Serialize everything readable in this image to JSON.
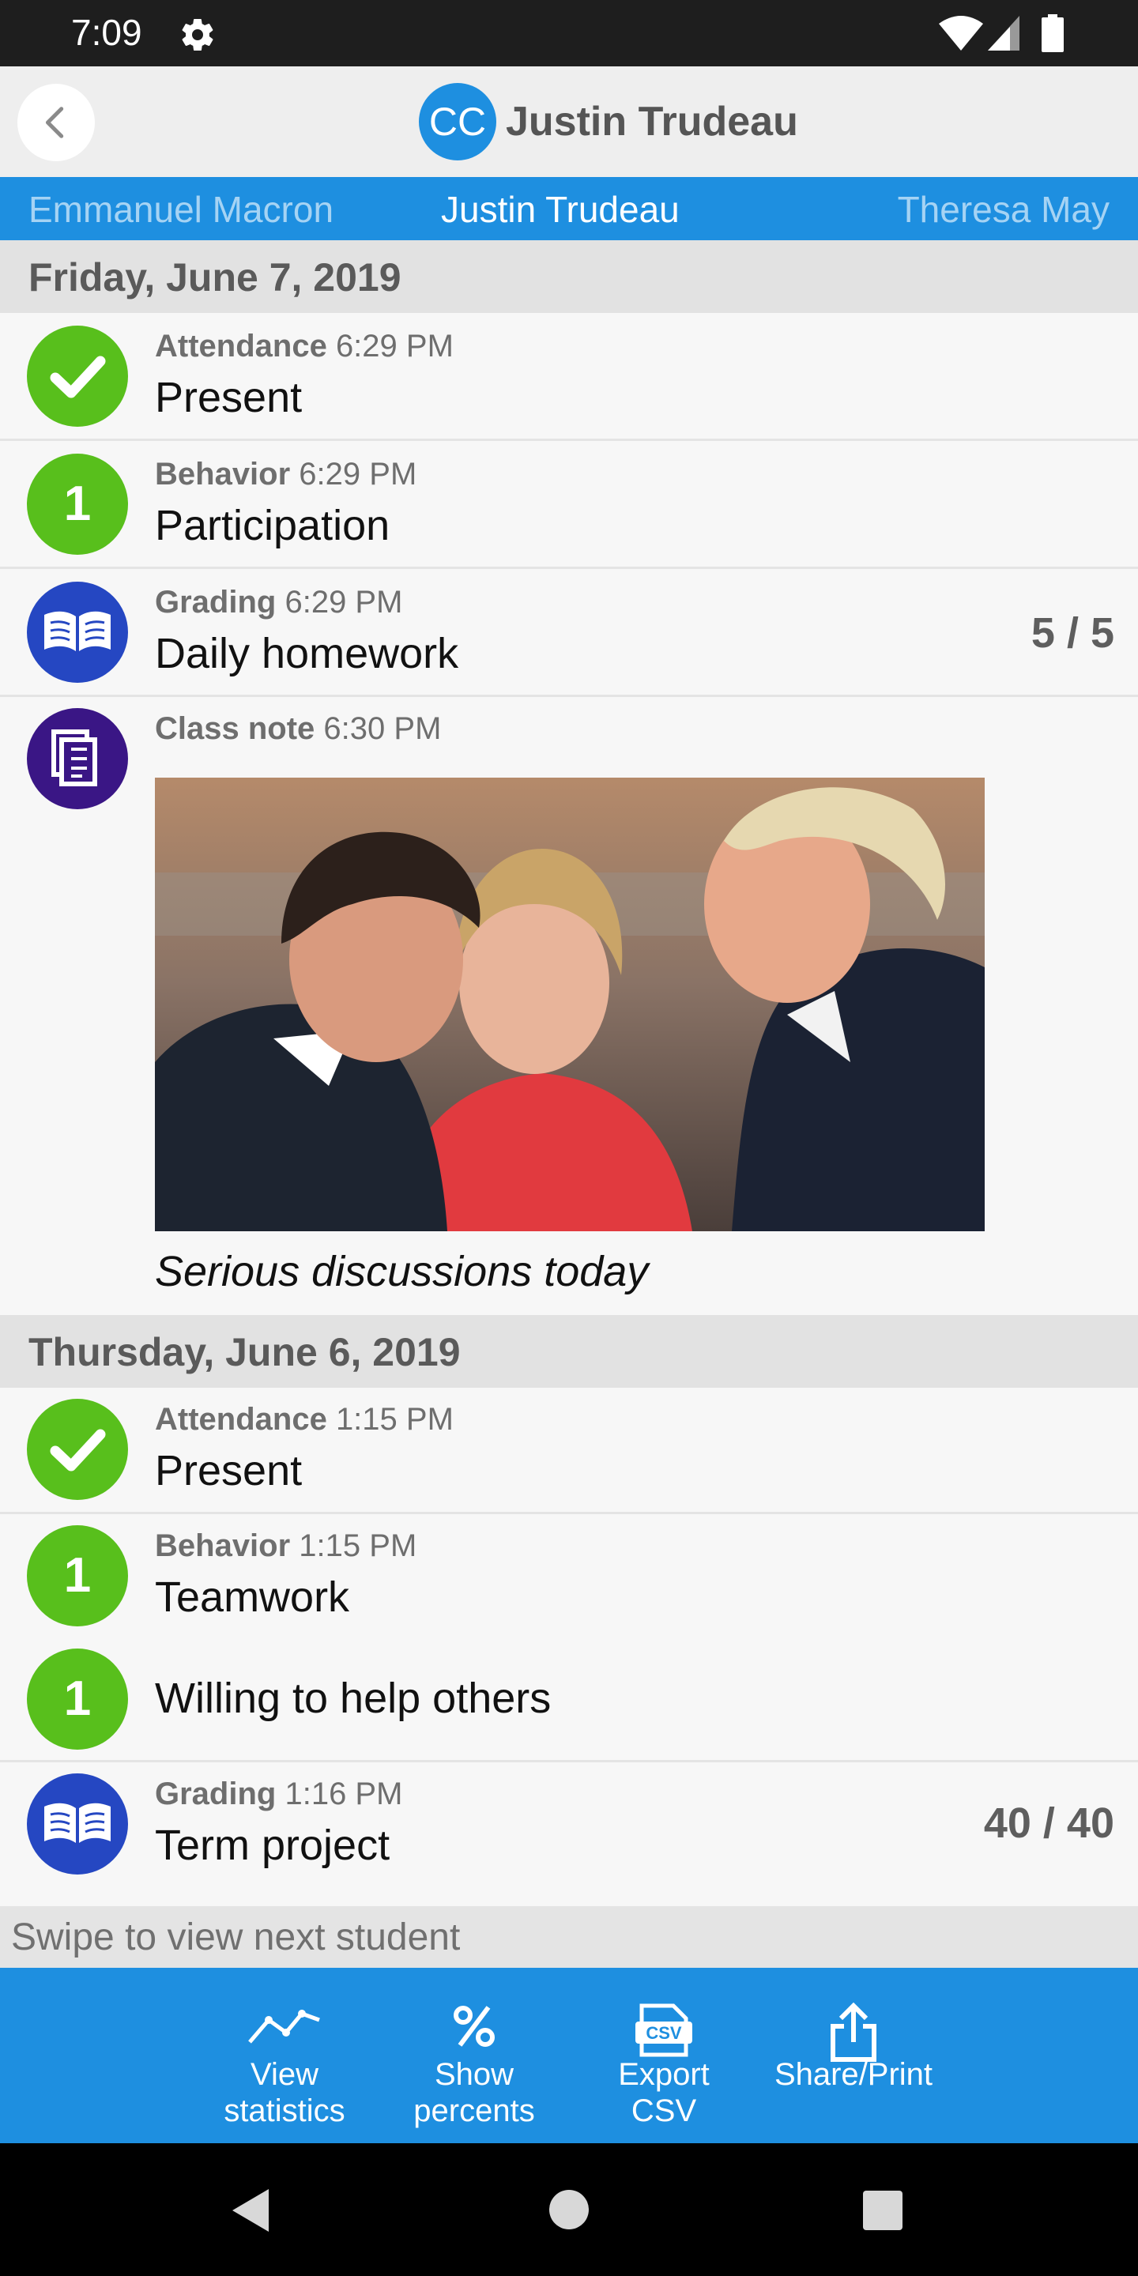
{
  "status_bar": {
    "time": "7:09",
    "icons": [
      "gear-icon",
      "wifi-icon",
      "cell-signal-icon",
      "battery-icon"
    ]
  },
  "app_bar": {
    "badge": "CC",
    "title": "Justin Trudeau",
    "back_icon": "chevron-left-icon"
  },
  "student_tabs": {
    "previous": "Emmanuel Macron",
    "current": "Justin Trudeau",
    "next": "Theresa May"
  },
  "days": [
    {
      "date": "Friday, June 7, 2019",
      "entries": [
        {
          "type": "Attendance",
          "time": "6:29 PM",
          "value": "Present",
          "icon": "checkmark-icon"
        },
        {
          "type": "Behavior",
          "time": "6:29 PM",
          "value": "Participation",
          "icon_text": "1"
        },
        {
          "type": "Grading",
          "time": "6:29 PM",
          "value": "Daily homework",
          "score": "5 / 5",
          "icon": "book-icon"
        },
        {
          "type": "Class note",
          "time": "6:30 PM",
          "caption": "Serious discussions today",
          "icon": "notes-icon"
        }
      ]
    },
    {
      "date": "Thursday, June 6, 2019",
      "entries": [
        {
          "type": "Attendance",
          "time": "1:15 PM",
          "value": "Present",
          "icon": "checkmark-icon"
        },
        {
          "type": "Behavior",
          "time": "1:15 PM",
          "value": "Teamwork",
          "icon_text": "1"
        },
        {
          "value": "Willing to help others",
          "icon_text": "1"
        },
        {
          "type": "Grading",
          "time": "1:16 PM",
          "value": "Term project",
          "score": "40 / 40",
          "icon": "book-icon"
        }
      ]
    }
  ],
  "swipe_hint": "Swipe to view next student",
  "toolbar": [
    {
      "line1": "View",
      "line2": "statistics",
      "icon": "statistics-icon"
    },
    {
      "line1": "Show",
      "line2": "percents",
      "icon": "percent-icon"
    },
    {
      "line1": "Export",
      "line2": "CSV",
      "icon": "csv-icon"
    },
    {
      "line1": "Share/Print",
      "line2": "",
      "icon": "share-icon"
    }
  ],
  "colors": {
    "accent": "#1e8fe0",
    "green": "#58bf1c",
    "blue": "#2547c2",
    "purple": "#3a1685"
  }
}
